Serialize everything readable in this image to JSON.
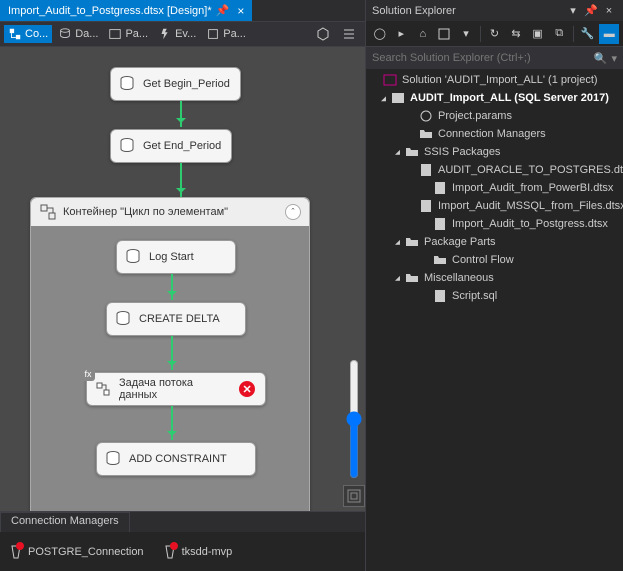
{
  "tab": {
    "label": "Import_Audit_to_Postgress.dtsx [Design]*"
  },
  "toolbar": {
    "items": [
      {
        "label": "Co...",
        "selected": true
      },
      {
        "label": "Da..."
      },
      {
        "label": "Pa..."
      },
      {
        "label": "Ev..."
      },
      {
        "label": "Pa..."
      }
    ]
  },
  "flow": {
    "n1": "Get Begin_Period",
    "n2": "Get End_Period",
    "seqTitle": "Контейнер \"Цикл по элементам\"",
    "s1": "Log Start",
    "s2": "CREATE DELTA",
    "s3": "Задача потока данных",
    "s4": "ADD CONSTRAINT"
  },
  "connMgr": {
    "tab": "Connection Managers",
    "items": [
      "POSTGRE_Connection",
      "tksdd-mvp"
    ]
  },
  "solEx": {
    "title": "Solution Explorer",
    "searchPlaceholder": "Search Solution Explorer (Ctrl+;)",
    "root": "Solution 'AUDIT_Import_ALL' (1 project)",
    "project": "AUDIT_Import_ALL (SQL Server 2017)",
    "nodes": {
      "params": "Project.params",
      "connMgrs": "Connection Managers",
      "ssis": "SSIS Packages",
      "p1": "AUDIT_ORACLE_TO_POSTGRES.dtsx",
      "p2": "Import_Audit_from_PowerBI.dtsx",
      "p3": "Import_Audit_MSSQL_from_Files.dtsx",
      "p4": "Import_Audit_to_Postgress.dtsx",
      "parts": "Package Parts",
      "cflow": "Control Flow",
      "misc": "Miscellaneous",
      "script": "Script.sql"
    }
  }
}
